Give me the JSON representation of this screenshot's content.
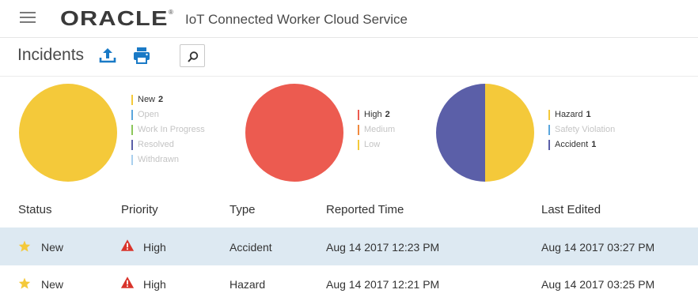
{
  "header": {
    "logo_text": "ORACLE",
    "logo_mark": "®",
    "app_title": "IoT Connected Worker Cloud Service",
    "menu_icon": "hamburger-menu-icon"
  },
  "toolbar": {
    "title": "Incidents",
    "upload_icon": "upload-icon",
    "print_icon": "print-icon",
    "search_icon": "search-icon"
  },
  "colors": {
    "yellow": "#f4c93a",
    "red": "#ec5b50",
    "blue_legend": "#5aa6dd",
    "green": "#8cc65a",
    "purple": "#5b5fa8",
    "light_blue": "#a9cfee",
    "orange": "#f08a3e",
    "accent_blue": "#1a7ac6",
    "selected_row": "#dde9f2",
    "warning_red": "#d9342b"
  },
  "charts": [
    {
      "name": "status",
      "slices": [
        {
          "label": "New",
          "value": 2,
          "color": "#f4c93a"
        }
      ],
      "legend": [
        {
          "label": "New",
          "count": "2",
          "color": "#f4c93a",
          "active": true
        },
        {
          "label": "Open",
          "count": "",
          "color": "#5aa6dd",
          "active": false
        },
        {
          "label": "Work In Progress",
          "count": "",
          "color": "#8cc65a",
          "active": false
        },
        {
          "label": "Resolved",
          "count": "",
          "color": "#5b5fa8",
          "active": false
        },
        {
          "label": "Withdrawn",
          "count": "",
          "color": "#a9cfee",
          "active": false
        }
      ]
    },
    {
      "name": "priority",
      "slices": [
        {
          "label": "High",
          "value": 2,
          "color": "#ec5b50"
        }
      ],
      "legend": [
        {
          "label": "High",
          "count": "2",
          "color": "#ec5b50",
          "active": true
        },
        {
          "label": "Medium",
          "count": "",
          "color": "#f08a3e",
          "active": false
        },
        {
          "label": "Low",
          "count": "",
          "color": "#f4c93a",
          "active": false
        }
      ]
    },
    {
      "name": "type",
      "slices": [
        {
          "label": "Hazard",
          "value": 1,
          "color": "#f4c93a"
        },
        {
          "label": "Accident",
          "value": 1,
          "color": "#5b5fa8"
        }
      ],
      "legend": [
        {
          "label": "Hazard",
          "count": "1",
          "color": "#f4c93a",
          "active": true
        },
        {
          "label": "Safety Violation",
          "count": "",
          "color": "#5aa6dd",
          "active": false
        },
        {
          "label": "Accident",
          "count": "1",
          "color": "#5b5fa8",
          "active": true
        }
      ]
    }
  ],
  "table": {
    "columns": [
      "Status",
      "Priority",
      "Type",
      "Reported Time",
      "Last Edited"
    ],
    "rows": [
      {
        "status": "New",
        "priority": "High",
        "type": "Accident",
        "reported": "Aug 14 2017 12:23 PM",
        "edited": "Aug 14 2017 03:27 PM",
        "selected": true
      },
      {
        "status": "New",
        "priority": "High",
        "type": "Hazard",
        "reported": "Aug 14 2017 12:21 PM",
        "edited": "Aug 14 2017 03:25 PM",
        "selected": false
      }
    ]
  }
}
